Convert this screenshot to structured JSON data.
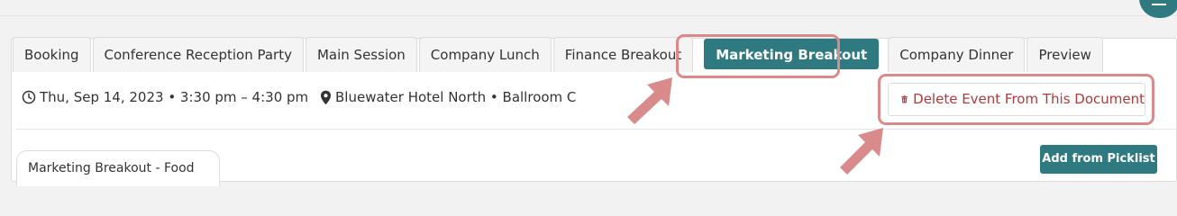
{
  "tabs": [
    {
      "label": "Booking"
    },
    {
      "label": "Conference Reception Party"
    },
    {
      "label": "Main Session"
    },
    {
      "label": "Company Lunch"
    },
    {
      "label": "Finance Breakout"
    },
    {
      "label": "Marketing Breakout",
      "active": true
    },
    {
      "label": "Company Dinner"
    },
    {
      "label": "Preview"
    }
  ],
  "event": {
    "when": "Thu, Sep 14, 2023 • 3:30 pm – 4:30 pm",
    "where": "Bluewater Hotel North • Ballroom C"
  },
  "actions": {
    "delete_label": "Delete Event From This Document",
    "add_picklist_label": "Add from Picklist"
  },
  "sections": {
    "current_tab_label": "Marketing Breakout - Food"
  },
  "colors": {
    "accent": "#2f7a80",
    "danger": "#b03a3a",
    "annotation": "#d98a8a"
  },
  "icons": {
    "menu": "hamburger-icon",
    "when": "clock-icon",
    "where": "map-pin-icon",
    "delete": "trash-icon"
  }
}
